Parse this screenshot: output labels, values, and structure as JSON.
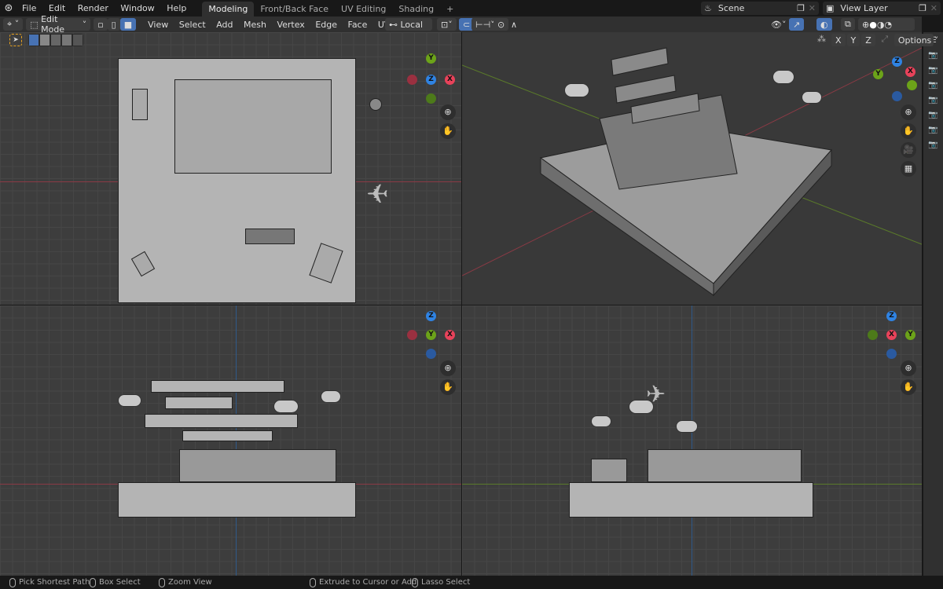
{
  "topbar": {
    "menus": [
      "File",
      "Edit",
      "Render",
      "Window",
      "Help"
    ],
    "workspaces": [
      "Modeling",
      "Front/Back Face",
      "UV Editing",
      "Shading"
    ],
    "active_workspace": "Modeling",
    "add_tab": "+",
    "scene": "Scene",
    "view_layer": "View Layer"
  },
  "header": {
    "mode": "Edit Mode",
    "menus": [
      "View",
      "Select",
      "Add",
      "Mesh",
      "Vertex",
      "Edge",
      "Face",
      "UV"
    ],
    "pivot": "Local",
    "options": "Options",
    "axes": [
      "X",
      "Y",
      "Z"
    ]
  },
  "gizmo": {
    "x": "X",
    "y": "Y",
    "z": "Z"
  },
  "colors": {
    "x": "#e8425a",
    "y": "#6ca319",
    "z": "#2f83e3",
    "accent": "#4772b3"
  },
  "status": [
    "Pick Shortest Path",
    "Box Select",
    "Zoom View",
    "Extrude to Cursor or Add",
    "Lasso Select"
  ]
}
